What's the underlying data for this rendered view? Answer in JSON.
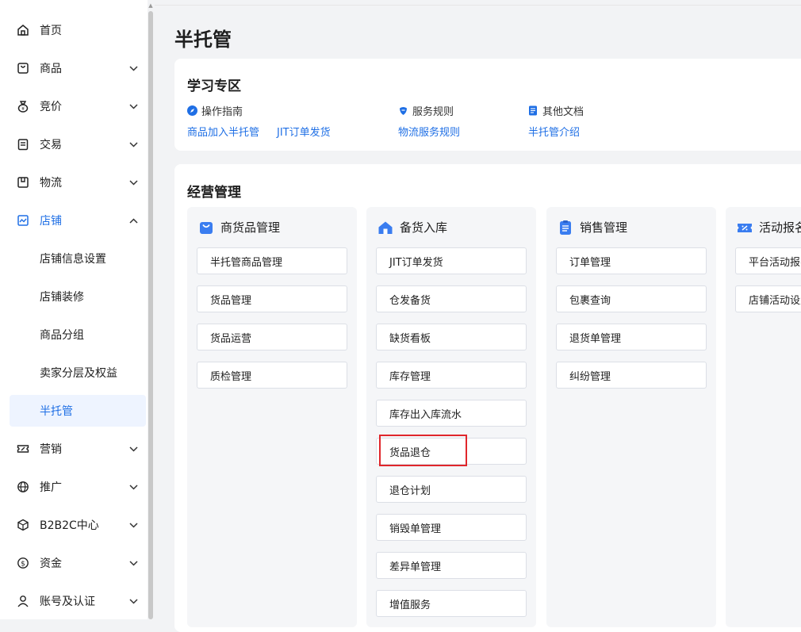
{
  "sidebar": {
    "items": [
      {
        "label": "首页",
        "icon": "home-icon"
      },
      {
        "label": "商品",
        "icon": "shopping-bag-icon"
      },
      {
        "label": "竞价",
        "icon": "money-bag-icon"
      },
      {
        "label": "交易",
        "icon": "clipboard-icon"
      },
      {
        "label": "物流",
        "icon": "warehouse-icon"
      },
      {
        "label": "店铺",
        "icon": "shop-chart-icon"
      },
      {
        "label": "营销",
        "icon": "ticket-icon"
      },
      {
        "label": "推广",
        "icon": "globe-icon"
      },
      {
        "label": "B2B2C中心",
        "icon": "cube-icon"
      },
      {
        "label": "资金",
        "icon": "dollar-icon"
      },
      {
        "label": "账号及认证",
        "icon": "user-icon"
      }
    ],
    "store_sub_items": [
      {
        "label": "店铺信息设置"
      },
      {
        "label": "店铺装修"
      },
      {
        "label": "商品分组"
      },
      {
        "label": "卖家分层及权益"
      },
      {
        "label": "半托管"
      }
    ]
  },
  "page": {
    "title": "半托管"
  },
  "learning": {
    "title": "学习专区",
    "sections": [
      {
        "heading": "操作指南",
        "icon": "compass-icon",
        "links": [
          "商品加入半托管",
          "JIT订单发货"
        ]
      },
      {
        "heading": "服务规则",
        "icon": "shield-icon",
        "links": [
          "物流服务规则"
        ]
      },
      {
        "heading": "其他文档",
        "icon": "document-icon",
        "links": [
          "半托管介绍"
        ]
      }
    ]
  },
  "ops": {
    "title": "经营管理",
    "columns": [
      {
        "heading": "商货品管理",
        "icon": "bag-icon",
        "buttons": [
          "半托管商品管理",
          "货品管理",
          "货品运营",
          "质检管理"
        ]
      },
      {
        "heading": "备货入库",
        "icon": "house-icon",
        "buttons": [
          "JIT订单发货",
          "仓发备货",
          "缺货看板",
          "库存管理",
          "库存出入库流水",
          "货品退仓",
          "退仓计划",
          "销毁单管理",
          "差异单管理",
          "增值服务"
        ]
      },
      {
        "heading": "销售管理",
        "icon": "list-icon",
        "buttons": [
          "订单管理",
          "包裹查询",
          "退货单管理",
          "纠纷管理"
        ]
      },
      {
        "heading": "活动报名",
        "icon": "coupon-icon",
        "buttons": [
          "平台活动报名",
          "店铺活动设置"
        ]
      }
    ]
  },
  "colors": {
    "accent": "#1f6fe5",
    "highlight": "#e0262b"
  }
}
